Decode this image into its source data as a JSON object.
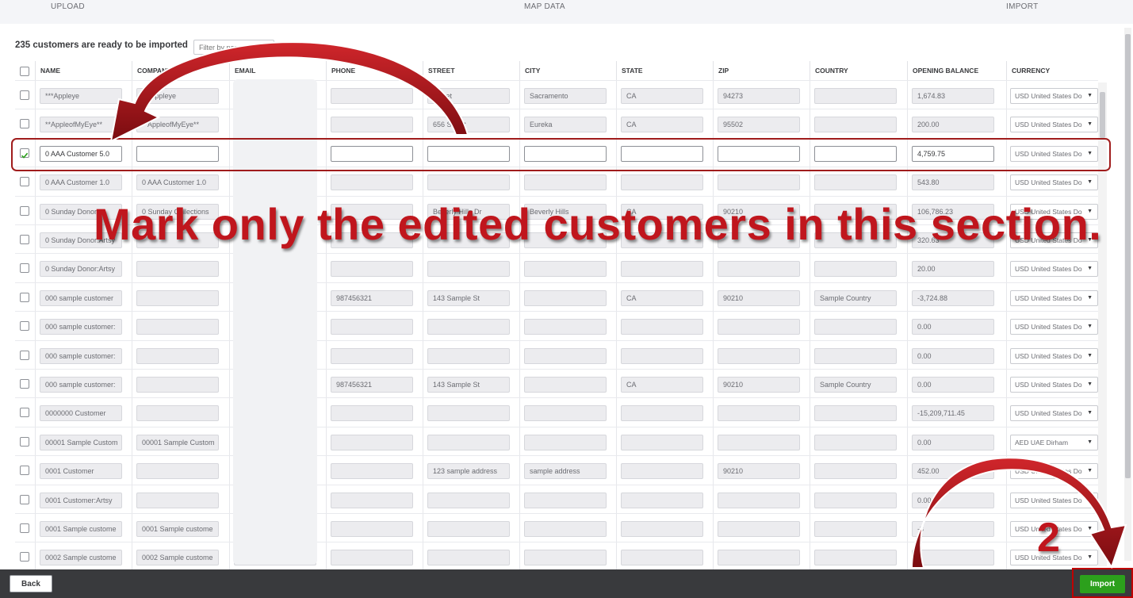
{
  "steps": [
    "UPLOAD",
    "MAP DATA",
    "IMPORT"
  ],
  "heading": "235 customers are ready to be imported",
  "filter_placeholder": "Filter by name",
  "columns": [
    "NAME",
    "COMPANY",
    "EMAIL",
    "PHONE",
    "STREET",
    "CITY",
    "STATE",
    "ZIP",
    "COUNTRY",
    "OPENING BALANCE",
    "CURRENCY"
  ],
  "rows": [
    {
      "checked": false,
      "name": "***Appleye",
      "company": "***Appleye",
      "email": "",
      "phone": "",
      "street": "Street",
      "city": "Sacramento",
      "state": "CA",
      "zip": "94273",
      "country": "",
      "balance": "1,674.83",
      "currency": "USD United States Do"
    },
    {
      "checked": false,
      "name": "**AppleofMyEye**",
      "company": "**AppleofMyEye**",
      "email": "",
      "phone": "",
      "street": "656 Street",
      "city": "Eureka",
      "state": "CA",
      "zip": "95502",
      "country": "",
      "balance": "200.00",
      "currency": "USD United States Do"
    },
    {
      "checked": true,
      "name": "0 AAA Customer 5.0",
      "company": "",
      "email": "",
      "phone": "",
      "street": "",
      "city": "",
      "state": "",
      "zip": "",
      "country": "",
      "balance": "4,759.75",
      "currency": "USD United States Do"
    },
    {
      "checked": false,
      "name": "0 AAA Customer 1.0",
      "company": "0 AAA Customer 1.0",
      "email": "",
      "phone": "",
      "street": "",
      "city": "",
      "state": "",
      "zip": "",
      "country": "",
      "balance": "543.80",
      "currency": "USD United States Do"
    },
    {
      "checked": false,
      "name": "0 Sunday Donor",
      "company": "0 Sunday Collections",
      "email": "",
      "phone": "",
      "street": "Beverly Hills Dr",
      "city": "Beverly Hills",
      "state": "CA",
      "zip": "90210",
      "country": "",
      "balance": "106,786.23",
      "currency": "USD United States Do"
    },
    {
      "checked": false,
      "name": "0 Sunday Donor:Artsy",
      "company": "",
      "email": "",
      "phone": "",
      "street": "",
      "city": "",
      "state": "",
      "zip": "",
      "country": "",
      "balance": "320.63",
      "currency": "USD United States Do"
    },
    {
      "checked": false,
      "name": "0 Sunday Donor:Artsy",
      "company": "",
      "email": "",
      "phone": "",
      "street": "",
      "city": "",
      "state": "",
      "zip": "",
      "country": "",
      "balance": "20.00",
      "currency": "USD United States Do"
    },
    {
      "checked": false,
      "name": "000 sample customer",
      "company": "",
      "email": "",
      "phone": "987456321",
      "street": "143 Sample St",
      "city": "",
      "state": "CA",
      "zip": "90210",
      "country": "Sample Country",
      "balance": "-3,724.88",
      "currency": "USD United States Do"
    },
    {
      "checked": false,
      "name": "000 sample customer:",
      "company": "",
      "email": "",
      "phone": "",
      "street": "",
      "city": "",
      "state": "",
      "zip": "",
      "country": "",
      "balance": "0.00",
      "currency": "USD United States Do"
    },
    {
      "checked": false,
      "name": "000 sample customer:",
      "company": "",
      "email": "",
      "phone": "",
      "street": "",
      "city": "",
      "state": "",
      "zip": "",
      "country": "",
      "balance": "0.00",
      "currency": "USD United States Do"
    },
    {
      "checked": false,
      "name": "000 sample customer:",
      "company": "",
      "email": "",
      "phone": "987456321",
      "street": "143 Sample St",
      "city": "",
      "state": "CA",
      "zip": "90210",
      "country": "Sample Country",
      "balance": "0.00",
      "currency": "USD United States Do"
    },
    {
      "checked": false,
      "name": "0000000 Customer",
      "company": "",
      "email": "",
      "phone": "",
      "street": "",
      "city": "",
      "state": "",
      "zip": "",
      "country": "",
      "balance": "-15,209,711.45",
      "currency": "USD United States Do"
    },
    {
      "checked": false,
      "name": "00001 Sample Custom",
      "company": "00001 Sample Custom",
      "email": "",
      "phone": "",
      "street": "",
      "city": "",
      "state": "",
      "zip": "",
      "country": "",
      "balance": "0.00",
      "currency": "AED UAE Dirham"
    },
    {
      "checked": false,
      "name": "0001 Customer",
      "company": "",
      "email": "",
      "phone": "",
      "street": "123 sample address",
      "city": "sample address",
      "state": "",
      "zip": "90210",
      "country": "",
      "balance": "452.00",
      "currency": "USD United States Do"
    },
    {
      "checked": false,
      "name": "0001 Customer:Artsy",
      "company": "",
      "email": "",
      "phone": "",
      "street": "",
      "city": "",
      "state": "",
      "zip": "",
      "country": "",
      "balance": "0.00",
      "currency": "USD United States Do"
    },
    {
      "checked": false,
      "name": "0001 Sample custome",
      "company": "0001 Sample custome",
      "email": "",
      "phone": "",
      "street": "",
      "city": "",
      "state": "",
      "zip": "",
      "country": "",
      "balance": "-3",
      "currency": "USD United States Do"
    },
    {
      "checked": false,
      "name": "0002 Sample custome",
      "company": "0002 Sample custome",
      "email": "",
      "phone": "",
      "street": "",
      "city": "",
      "state": "",
      "zip": "",
      "country": "",
      "balance": "",
      "currency": "USD United States Do"
    }
  ],
  "footer": {
    "back_label": "Back",
    "import_label": "Import"
  },
  "annotation": {
    "instruction": "Mark only the edited customers in this section.",
    "step_number": "2",
    "accent_color": "#c0161d"
  },
  "colors": {
    "import_green": "#2ca01c",
    "footer_bg": "#393a3d"
  },
  "icons": {
    "checkmark": "check-icon",
    "dropdown": "caret-down-icon"
  }
}
